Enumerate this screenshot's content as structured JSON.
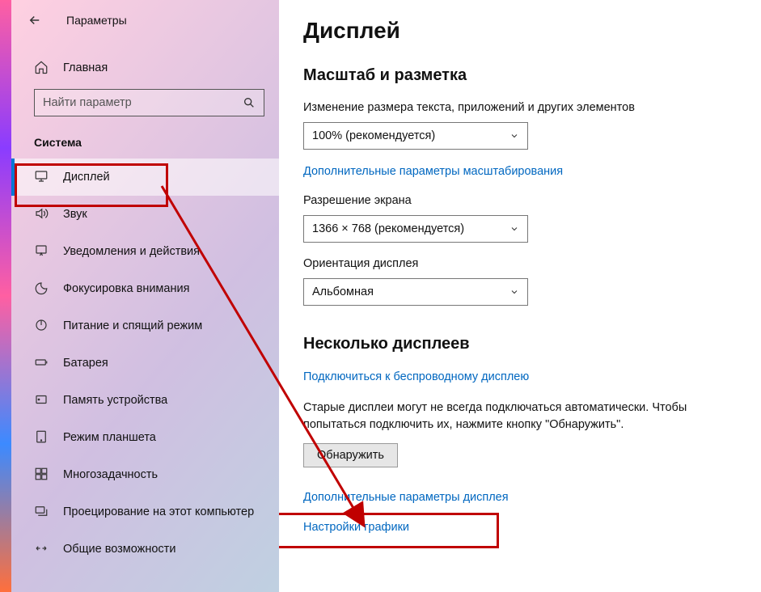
{
  "app_title": "Параметры",
  "home_label": "Главная",
  "search_placeholder": "Найти параметр",
  "group_label": "Система",
  "sidebar": [
    {
      "icon": "display",
      "label": "Дисплей",
      "selected": true
    },
    {
      "icon": "sound",
      "label": "Звук"
    },
    {
      "icon": "notify",
      "label": "Уведомления и действия"
    },
    {
      "icon": "focus",
      "label": "Фокусировка внимания"
    },
    {
      "icon": "power",
      "label": "Питание и спящий режим"
    },
    {
      "icon": "battery",
      "label": "Батарея"
    },
    {
      "icon": "storage",
      "label": "Память устройства"
    },
    {
      "icon": "tablet",
      "label": "Режим планшета"
    },
    {
      "icon": "multi",
      "label": "Многозадачность"
    },
    {
      "icon": "project",
      "label": "Проецирование на этот компьютер"
    },
    {
      "icon": "shared",
      "label": "Общие возможности"
    }
  ],
  "page": {
    "title": "Дисплей",
    "section1_title": "Масштаб и разметка",
    "scale_label": "Изменение размера текста, приложений и других элементов",
    "scale_value": "100% (рекомендуется)",
    "advanced_scaling_link": "Дополнительные параметры масштабирования",
    "resolution_label": "Разрешение экрана",
    "resolution_value": "1366 × 768 (рекомендуется)",
    "orientation_label": "Ориентация дисплея",
    "orientation_value": "Альбомная",
    "section2_title": "Несколько дисплеев",
    "wireless_link": "Подключиться к беспроводному дисплею",
    "detect_desc": "Старые дисплеи могут не всегда подключаться автоматически. Чтобы попытаться подключить их, нажмите кнопку \"Обнаружить\".",
    "detect_button": "Обнаружить",
    "advanced_display_link": "Дополнительные параметры дисплея",
    "graphics_link": "Настройки графики"
  }
}
